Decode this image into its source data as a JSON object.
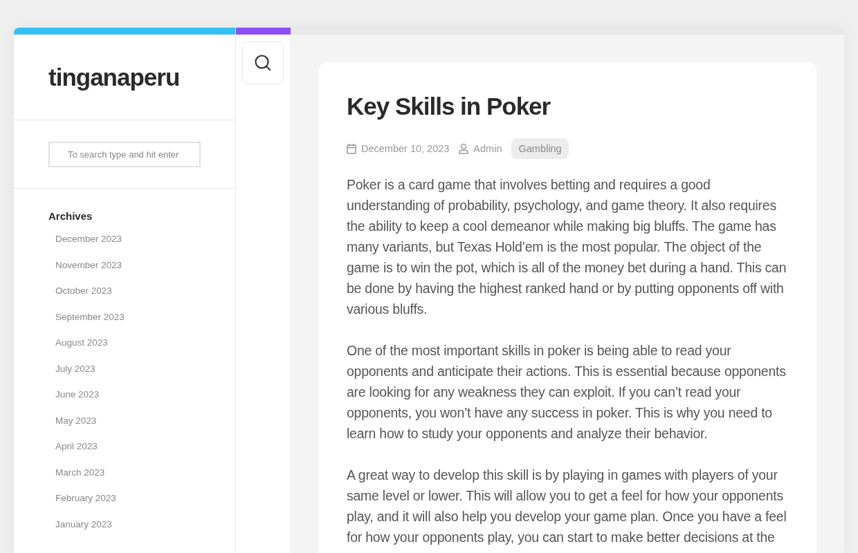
{
  "site_title": "tinganaperu",
  "search": {
    "placeholder": "To search type and hit enter"
  },
  "archives": {
    "title": "Archives",
    "items": [
      "December 2023",
      "November 2023",
      "October 2023",
      "September 2023",
      "August 2023",
      "July 2023",
      "June 2023",
      "May 2023",
      "April 2023",
      "March 2023",
      "February 2023",
      "January 2023"
    ]
  },
  "post": {
    "title": "Key Skills in Poker",
    "date": "December 10, 2023",
    "author": "Admin",
    "category": "Gambling",
    "paragraphs": [
      "Poker is a card game that involves betting and requires a good understanding of probability, psychology, and game theory. It also requires the ability to keep a cool demeanor while making big bluffs. The game has many variants, but Texas Hold’em is the most popular. The object of the game is to win the pot, which is all of the money bet during a hand. This can be done by having the highest ranked hand or by putting opponents off with various bluffs.",
      "One of the most important skills in poker is being able to read your opponents and anticipate their actions. This is essential because opponents are looking for any weakness they can exploit. If you can’t read your opponents, you won’t have any success in poker. This is why you need to learn how to study your opponents and analyze their behavior.",
      "A great way to develop this skill is by playing in games with players of your same level or lower. This will allow you to get a feel for how your opponents play, and it will also help you develop your game plan. Once you have a feel for how your opponents play, you can start to make better decisions at the"
    ]
  }
}
